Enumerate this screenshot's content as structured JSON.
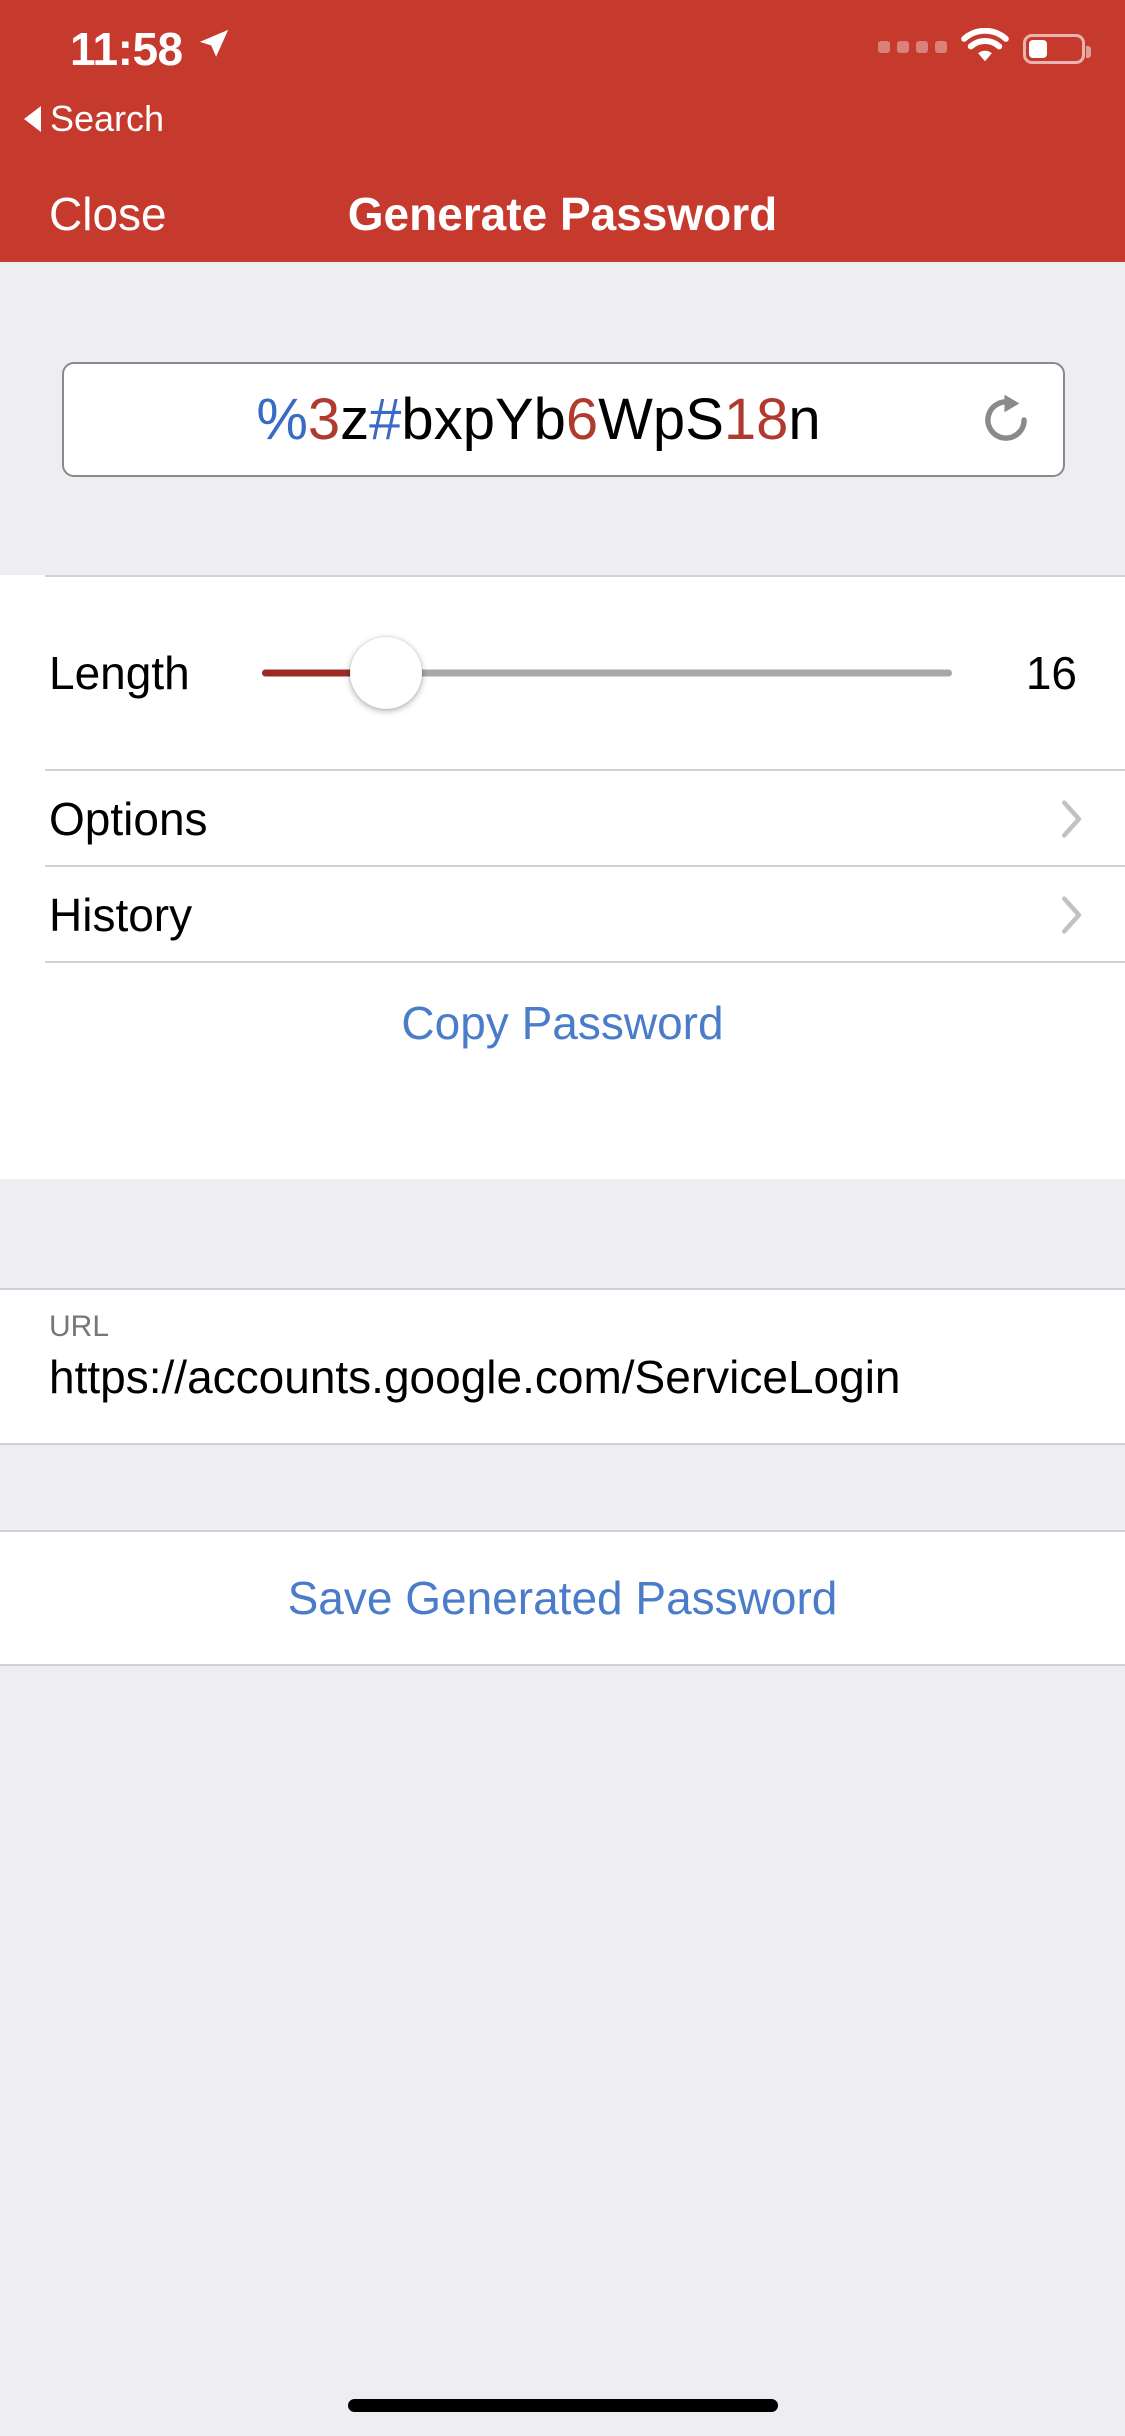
{
  "status_bar": {
    "time": "11:58",
    "location_icon": "location-arrow-icon",
    "signal_dots": 4,
    "wifi_icon": "wifi-icon",
    "battery_icon": "battery-icon",
    "battery_level_pct": 36
  },
  "back_link": {
    "label": "Search",
    "icon": "back-triangle-icon"
  },
  "nav": {
    "close_label": "Close",
    "title": "Generate Password"
  },
  "password_field": {
    "value": "%3z#bxpYb6WpS18n",
    "characters": [
      {
        "ch": "%",
        "color": "#3a6bc4"
      },
      {
        "ch": "3",
        "color": "#b03a2e"
      },
      {
        "ch": "z",
        "color": "#000000"
      },
      {
        "ch": "#",
        "color": "#3a6bc4"
      },
      {
        "ch": "b",
        "color": "#000000"
      },
      {
        "ch": "x",
        "color": "#000000"
      },
      {
        "ch": "p",
        "color": "#000000"
      },
      {
        "ch": "Y",
        "color": "#000000"
      },
      {
        "ch": "b",
        "color": "#000000"
      },
      {
        "ch": "6",
        "color": "#b03a2e"
      },
      {
        "ch": "W",
        "color": "#000000"
      },
      {
        "ch": "p",
        "color": "#000000"
      },
      {
        "ch": "S",
        "color": "#000000"
      },
      {
        "ch": "1",
        "color": "#b03a2e"
      },
      {
        "ch": "8",
        "color": "#b03a2e"
      },
      {
        "ch": "n",
        "color": "#000000"
      }
    ],
    "refresh_icon": "refresh-icon"
  },
  "length_row": {
    "label": "Length",
    "value": "16",
    "slider_fill_pct": 18
  },
  "menu_rows": [
    {
      "label": "Options",
      "chevron": "chevron-right-icon"
    },
    {
      "label": "History",
      "chevron": "chevron-right-icon"
    }
  ],
  "copy_action": {
    "label": "Copy Password"
  },
  "url_section": {
    "label": "URL",
    "value": "https://accounts.google.com/ServiceLogin"
  },
  "save_action": {
    "label": "Save Generated Password"
  },
  "colors": {
    "header_red": "#c63a2e",
    "accent_blue": "#4a7cc9",
    "page_background": "#eeeef2",
    "slider_fill": "#9d2b25"
  }
}
